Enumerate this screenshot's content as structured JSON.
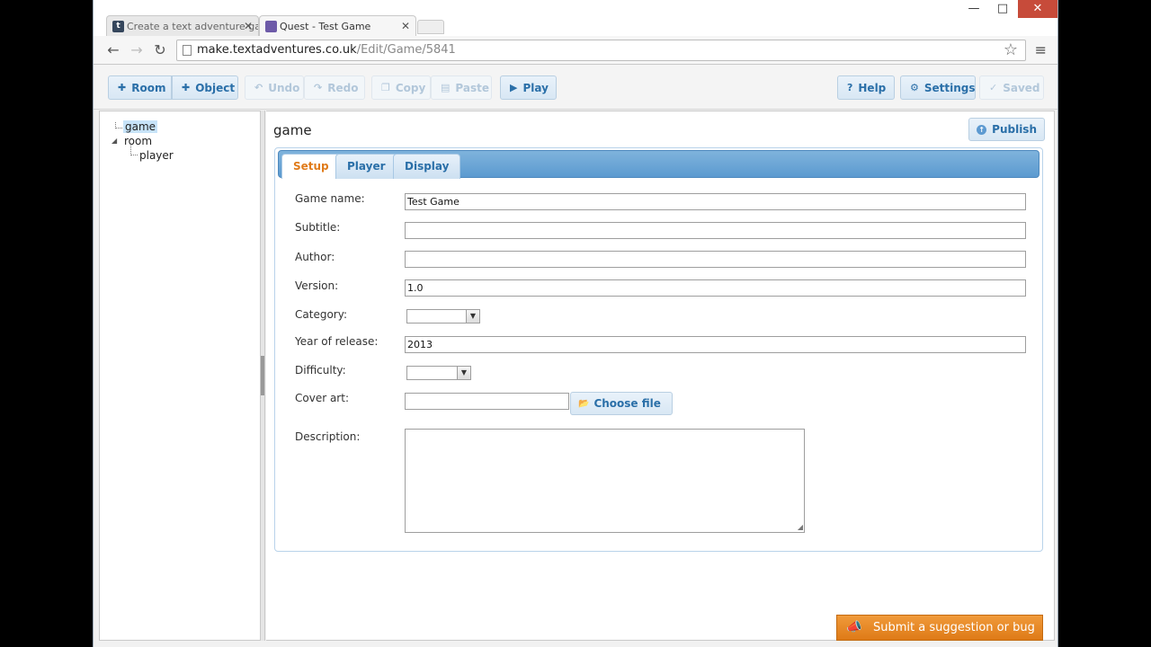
{
  "browser": {
    "tabs": [
      {
        "title": "Create a text adventure ga",
        "favicon": "t"
      },
      {
        "title": "Quest - Test Game",
        "favicon": ""
      }
    ],
    "url_host": "make.textadventures.co.uk",
    "url_path": "/Edit/Game/5841",
    "window_controls": {
      "minimize": "—",
      "maximize": "□",
      "close": "✕"
    }
  },
  "toolbar": {
    "room": "Room",
    "object": "Object",
    "undo": "Undo",
    "redo": "Redo",
    "copy": "Copy",
    "paste": "Paste",
    "play": "Play",
    "help": "Help",
    "settings": "Settings",
    "saved": "Saved"
  },
  "tree": {
    "items": [
      "game",
      "room",
      "player"
    ]
  },
  "editor": {
    "title": "game",
    "publish": "Publish",
    "tabs": [
      "Setup",
      "Player",
      "Display"
    ],
    "active_tab": "Setup",
    "fields": {
      "game_name_label": "Game name:",
      "game_name_value": "Test Game",
      "subtitle_label": "Subtitle:",
      "subtitle_value": "",
      "author_label": "Author:",
      "author_value": "",
      "version_label": "Version:",
      "version_value": "1.0",
      "category_label": "Category:",
      "year_label": "Year of release:",
      "year_value": "2013",
      "difficulty_label": "Difficulty:",
      "cover_art_label": "Cover art:",
      "choose_file": "Choose file",
      "description_label": "Description:"
    }
  },
  "feedback": {
    "label": "Submit a suggestion or bug"
  },
  "colors": {
    "accent_blue": "#2a6fa8",
    "active_tab_orange": "#e07b1a",
    "feedback_orange": "#de7a17",
    "tab_bar_blue": "#5b9ad0"
  }
}
